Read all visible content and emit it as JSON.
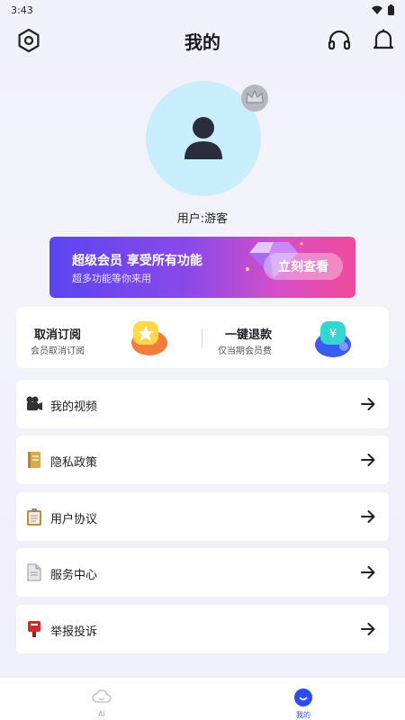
{
  "status_bar": {
    "time": "3:43"
  },
  "header": {
    "title": "我的"
  },
  "profile": {
    "username": "用户:游客"
  },
  "vip_banner": {
    "title": "超级会员 享受所有功能",
    "subtitle": "超多功能等你来用",
    "button_label": "立刻查看"
  },
  "quick_actions": [
    {
      "title": "取消订阅",
      "subtitle": "会员取消订阅"
    },
    {
      "title": "一键退款",
      "subtitle": "仅当期会员费"
    }
  ],
  "menu": [
    {
      "label": "我的视频",
      "icon": "video-camera-icon"
    },
    {
      "label": "隐私政策",
      "icon": "notebook-icon"
    },
    {
      "label": "用户协议",
      "icon": "clipboard-icon"
    },
    {
      "label": "服务中心",
      "icon": "document-icon"
    },
    {
      "label": "举报投诉",
      "icon": "postbox-icon"
    }
  ],
  "tabbar": {
    "tabs": [
      {
        "label": "AI",
        "icon": "cloud-icon",
        "active": false
      },
      {
        "label": "我的",
        "icon": "smile-icon",
        "active": true
      }
    ]
  },
  "colors": {
    "accent": "#2f4cf0",
    "vip_gradient_start": "#5b45f0",
    "vip_gradient_end": "#f04a9a",
    "avatar_bg": "#c9eefb"
  }
}
